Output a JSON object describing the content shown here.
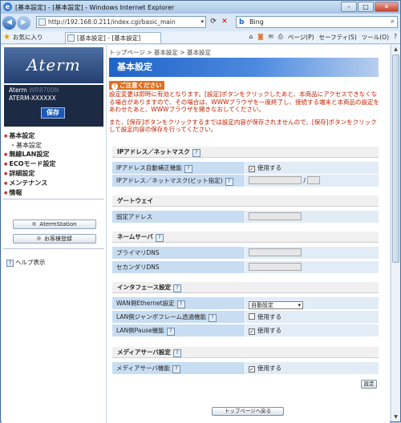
{
  "window": {
    "title": "[基本設定] - [基本設定] - Windows Internet Explorer"
  },
  "browser": {
    "url": "http://192.168.0.211/index.cgi/basic_main",
    "search_engine": "Bing",
    "favorites_label": "お気に入り",
    "tab_title": "[基本設定] - [基本設定]",
    "tools": [
      "ページ(P)",
      "セーフティ(S)",
      "ツール(O)",
      "?"
    ]
  },
  "sidebar": {
    "brand": "Aterm",
    "model_line": "Aterm",
    "device_name": "ATERM-XXXXXX",
    "save_label": "保存",
    "menu": [
      {
        "label": "基本設定",
        "sub": false
      },
      {
        "label": "基本設定",
        "sub": true
      },
      {
        "label": "無線LAN設定",
        "sub": false
      },
      {
        "label": "ECOモード設定",
        "sub": false
      },
      {
        "label": "詳細設定",
        "sub": false
      },
      {
        "label": "メンテナンス",
        "sub": false
      },
      {
        "label": "情報",
        "sub": false
      }
    ],
    "aterm_station": "AtermStation",
    "customer_reg": "お客様登録",
    "help": "ヘルプ表示"
  },
  "main": {
    "breadcrumb": "トップページ > 基本設定 > 基本設定",
    "title": "基本設定",
    "notice_badge": "ご注意ください",
    "notice1": "設定変更は即時に有効となります。[設定]ボタンをクリックしたあと、本商品にアクセスできなくなる場合がありますので、その場合は、WWWブラウザを一度終了し、接続する端末と本商品の設定をあわせたあと、WWWブラウザを開きなおしてください。",
    "notice2": "また、[保存]ボタンをクリックするまでは設定内容が保存されませんので、[保存]ボタンをクリックして設定内容の保存を行ってください。",
    "sections": {
      "ip": {
        "title": "IPアドレス／ネットマスク",
        "auto_label": "IPアドレス自動補正機能",
        "auto_value": "使用する",
        "ip_label": "IPアドレス／ネットマスク(ビット指定)",
        "slash": "/"
      },
      "gw": {
        "title": "ゲートウェイ",
        "fixed_label": "固定アドレス"
      },
      "ns": {
        "title": "ネームサーバ",
        "primary_label": "プライマリDNS",
        "secondary_label": "セカンダリDNS"
      },
      "if": {
        "title": "インタフェース設定",
        "wan_label": "WAN側Ethernet設定",
        "wan_value": "自動設定",
        "jumbo_label": "LAN側ジャンボフレーム透過機能",
        "jumbo_value": "使用する",
        "pause_label": "LAN側Pause機能",
        "pause_value": "使用する"
      },
      "media": {
        "title": "メディアサーバ設定",
        "func_label": "メディアサーバ機能",
        "func_value": "使用する"
      }
    },
    "set_button": "設定",
    "top_button": "トップページへ戻る"
  },
  "icons": {
    "help": "?",
    "checked": "✓"
  }
}
